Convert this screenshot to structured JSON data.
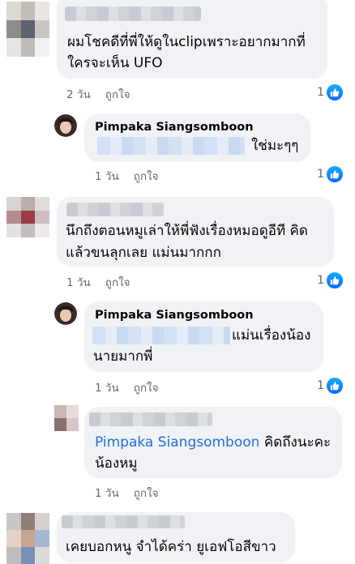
{
  "comments": [
    {
      "text_lines": [
        "ผมโชคดีที่พี่ให้ดูในclipเพราะอยากมากที่",
        "ใครจะเห็น UFO"
      ],
      "time": "2 วัน",
      "like_label": "ถูกใจ",
      "reaction_count": "1",
      "avatar_colors": [
        "#dcd8d2",
        "#c2bdb6",
        "#e9e6e2",
        "#8f8b86",
        "#5d6172",
        "#c9c6c4",
        "#e7e5e3",
        "#bebbb8",
        "#f2f1ef"
      ]
    },
    {
      "author": "Pimpaka Siangsomboon",
      "text_lines": [
        "ใช่มะๆๆ"
      ],
      "time": "1 วัน",
      "like_label": "ถูกใจ",
      "reaction_count": "1"
    },
    {
      "text_lines": [
        "นึกถึงตอนหมูเล่าให้พี่ฟังเรื่องหมอดูอีที คิด",
        "แล้วขนลุกเลย แม่นมากกก"
      ],
      "time": "1 วัน",
      "like_label": "ถูกใจ",
      "reaction_count": "1",
      "avatar_colors": [
        "#d9d3cf",
        "#b9aeab",
        "#e2dcd9",
        "#b58a8c",
        "#9b3b45",
        "#cdbfc1",
        "#e5e1e0",
        "#c5bcbc",
        "#ede9e8"
      ]
    },
    {
      "author": "Pimpaka Siangsomboon",
      "text_lines": [
        "แม่นเรื่องน้อง",
        "นายมากพี่"
      ],
      "time": "1 วัน",
      "like_label": "ถูกใจ",
      "reaction_count": "1"
    },
    {
      "mention": "Pimpaka Siangsomboon",
      "text_lines": [
        "คิดถึงนะคะ",
        "น้องหมู"
      ],
      "time": "1 วัน",
      "like_label": "ถูกใจ",
      "avatar_colors": [
        "#c9b8b6",
        "#e6dcda",
        "#8a6f70",
        "#d6c6c4"
      ]
    },
    {
      "text_lines": [
        "เคยบอกหนู จำได้คร่า ยูเอฟโอสีขาว"
      ],
      "avatar_colors": [
        "#cbc6c4",
        "#8f7f78",
        "#d6d0cc",
        "#e3d3c7",
        "#c7a48e",
        "#a6b6d1",
        "#bfbdbd",
        "#7a8fb6",
        "#dcdad8"
      ]
    }
  ],
  "colors": {
    "like_blue": "#0866ff",
    "mention_blue": "#216fdb",
    "bubble_bg": "#f0f2f5",
    "meta_gray": "#65676b"
  },
  "icons": {
    "reaction": "like-thumbs-up-icon"
  }
}
